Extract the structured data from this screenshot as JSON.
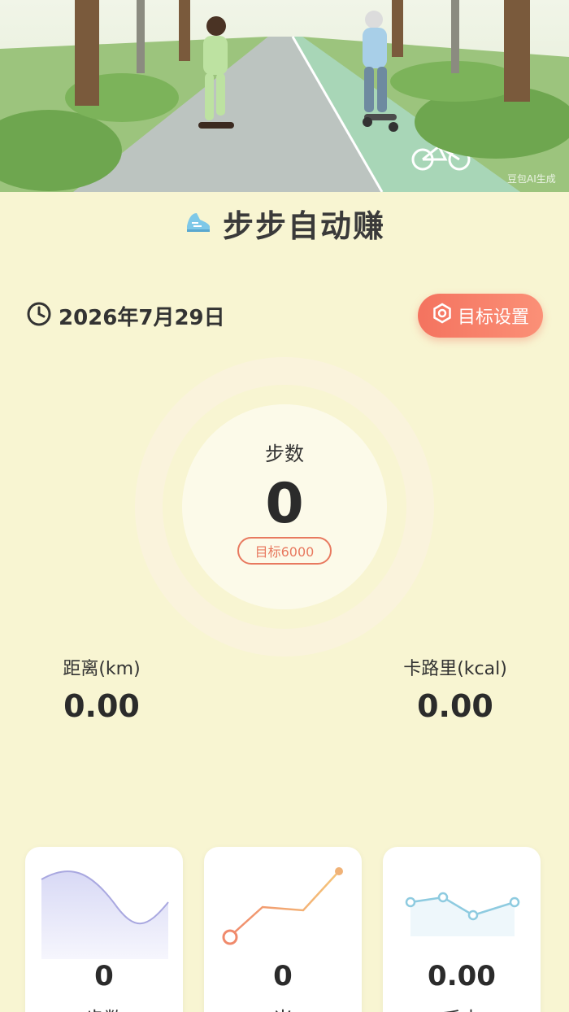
{
  "header": {
    "title": "步步自动赚",
    "watermark": "豆包AI生成"
  },
  "date": "2026年7月29日",
  "goal_button": "目标设置",
  "ring": {
    "label": "步数",
    "value": "0",
    "target": "目标6000"
  },
  "metrics": [
    {
      "label": "距离(km)",
      "value": "0.00"
    },
    {
      "label": "卡路里(kcal)",
      "value": "0.00"
    }
  ],
  "cards": [
    {
      "value": "0",
      "label": "步数"
    },
    {
      "value": "0",
      "label": "米"
    },
    {
      "value": "0.00",
      "label": "千卡"
    }
  ],
  "colors": {
    "accent": "#f4735f",
    "background": "#f8f5d2",
    "shoe": "#7ec8e8"
  },
  "icons": [
    "shoe-icon",
    "clock-icon",
    "settings-gear-icon"
  ]
}
